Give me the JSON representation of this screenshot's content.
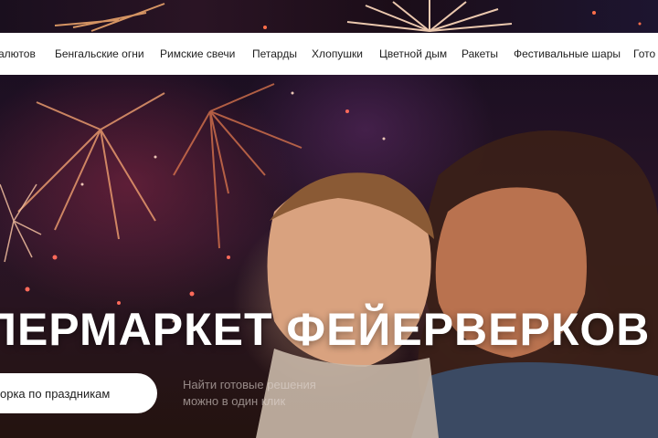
{
  "nav": {
    "items": [
      "алютов",
      "Бенгальские огни",
      "Римские свечи",
      "Петарды",
      "Хлопушки",
      "Цветной дым",
      "Ракеты",
      "Фестивальные шары",
      "Гото"
    ]
  },
  "hero": {
    "title": "ПЕРМАРКЕТ ФЕЙЕРВЕРКОВ",
    "button_label": "орка по праздникам",
    "hint_line1": "Найти готовые решения",
    "hint_line2": "можно в один клик"
  },
  "colors": {
    "nav_background": "#ffffff",
    "nav_text": "#1e1e1e",
    "hero_title": "#ffffff",
    "hint_text": "#e1d7d2"
  }
}
